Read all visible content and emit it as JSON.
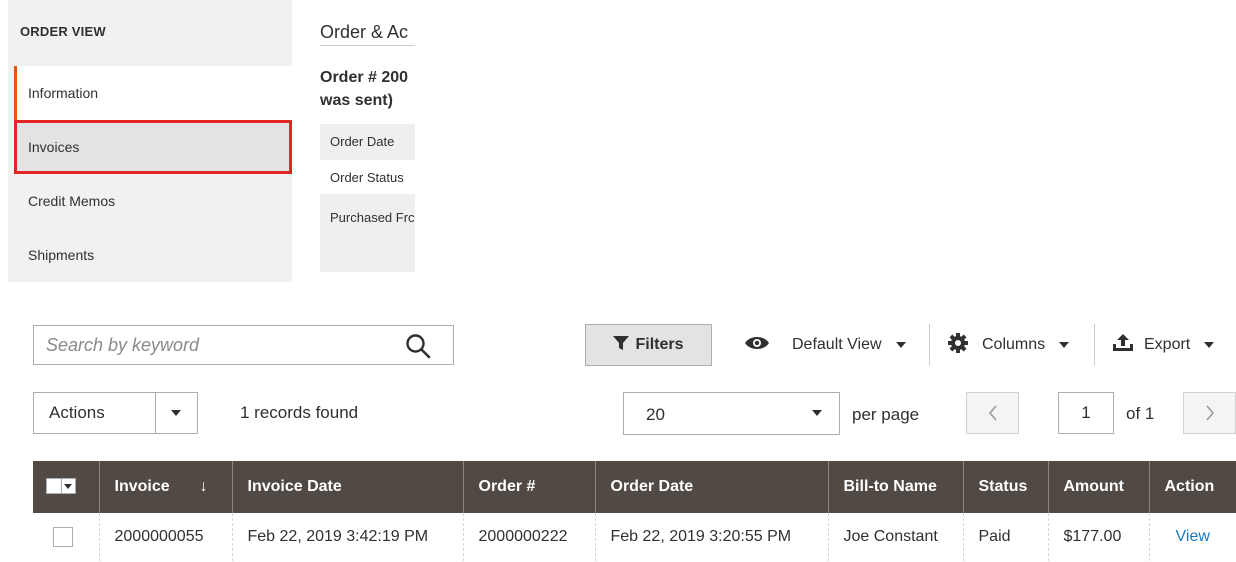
{
  "sidebar": {
    "title": "ORDER VIEW",
    "items": [
      {
        "label": "Information"
      },
      {
        "label": "Invoices"
      },
      {
        "label": "Credit Memos"
      },
      {
        "label": "Shipments"
      }
    ]
  },
  "order": {
    "title": "Order & Ac",
    "number_line1": "Order # 200",
    "number_line2": "was sent)",
    "fields": {
      "order_date": "Order Date",
      "order_status": "Order Status",
      "purchased_from": "Purchased Frc"
    }
  },
  "toolbar": {
    "search_placeholder": "Search by keyword",
    "filters_label": "Filters",
    "default_view_label": "Default View",
    "columns_label": "Columns",
    "export_label": "Export",
    "actions_label": "Actions",
    "records_found": "1 records found",
    "per_page_value": "20",
    "per_page_label": "per page",
    "page_current": "1",
    "page_total_label": "of 1"
  },
  "grid": {
    "columns": {
      "invoice": "Invoice",
      "invoice_date": "Invoice Date",
      "order_no": "Order #",
      "order_date": "Order Date",
      "bill_to": "Bill-to Name",
      "status": "Status",
      "amount": "Amount",
      "action": "Action"
    },
    "sort_indicator": "↓",
    "rows": [
      {
        "invoice": "2000000055",
        "invoice_date": "Feb 22, 2019 3:42:19 PM",
        "order_no": "2000000222",
        "order_date": "Feb 22, 2019 3:20:55 PM",
        "bill_to": "Joe Constant",
        "status": "Paid",
        "amount": "$177.00",
        "action": "View"
      }
    ]
  },
  "colors": {
    "accent": "#eb5202",
    "highlight": "#e22626",
    "grid_header": "#514943",
    "link": "#1979c3"
  }
}
